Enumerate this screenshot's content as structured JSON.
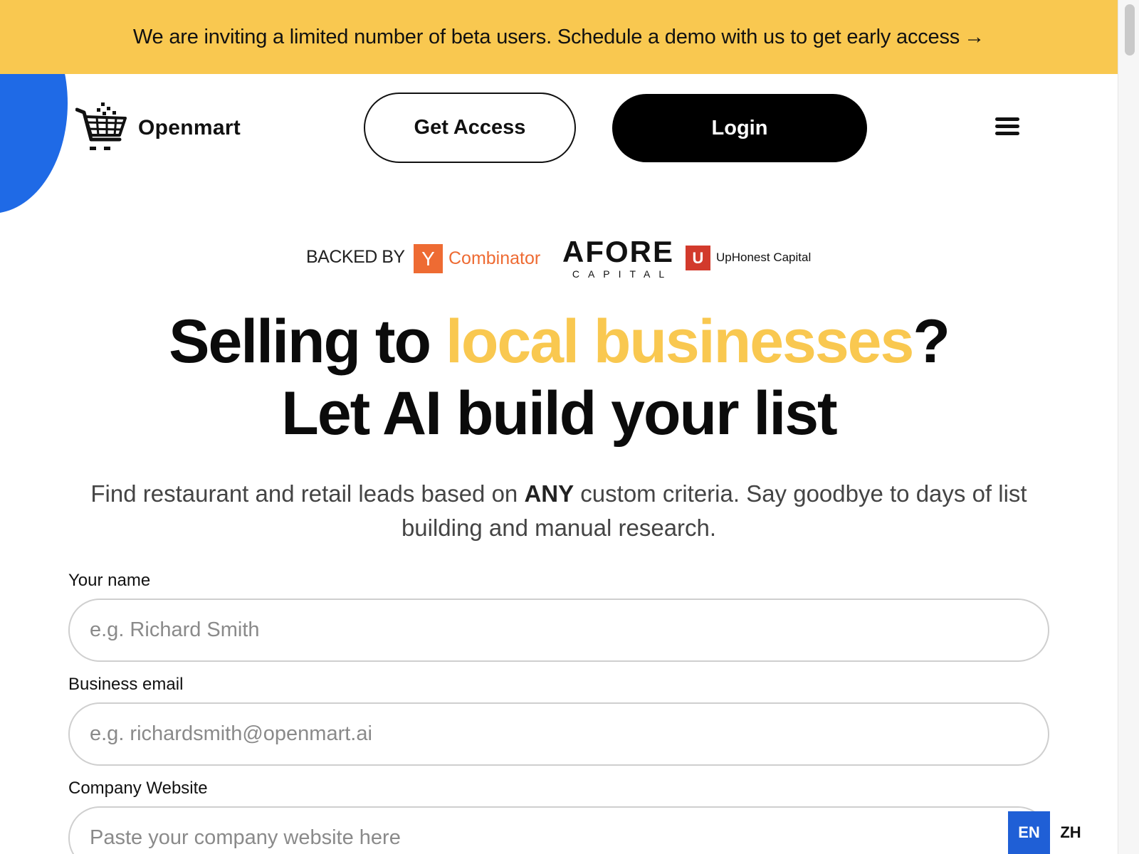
{
  "banner": {
    "text": "We are inviting a limited number of beta users. Schedule a demo with us to get early access",
    "arrow": "→"
  },
  "header": {
    "brand": "Openmart",
    "get_access": "Get Access",
    "login": "Login",
    "menu_icon": "hamburger-menu-icon"
  },
  "backers": {
    "label": "BACKED BY",
    "yc_letter": "Y",
    "yc_name": "Combinator",
    "afore_main": "AFORE",
    "afore_sub": "CAPITAL",
    "uphonest_mark": "U",
    "uphonest_name": "UpHonest Capital"
  },
  "hero": {
    "line1_pre": "Selling to ",
    "line1_highlight": "local businesses",
    "line1_post": "?",
    "line2": "Let AI build your list",
    "sub_pre": "Find restaurant and retail leads based on ",
    "sub_bold": "ANY",
    "sub_post": " custom criteria. Say goodbye to days of list building and manual research."
  },
  "form": {
    "name_label": "Your name",
    "name_placeholder": "e.g. Richard Smith",
    "email_label": "Business email",
    "email_placeholder": "e.g. richardsmith@openmart.ai",
    "website_label": "Company Website",
    "website_placeholder": "Paste your company website here"
  },
  "language": {
    "en": "EN",
    "zh": "ZH",
    "active": "EN"
  },
  "colors": {
    "banner": "#f9c850",
    "highlight": "#f9c850",
    "blob": "#1f6ae6",
    "yc": "#ee6b33",
    "uphonest": "#d23a2c",
    "lang_active": "#1f5fd6"
  }
}
